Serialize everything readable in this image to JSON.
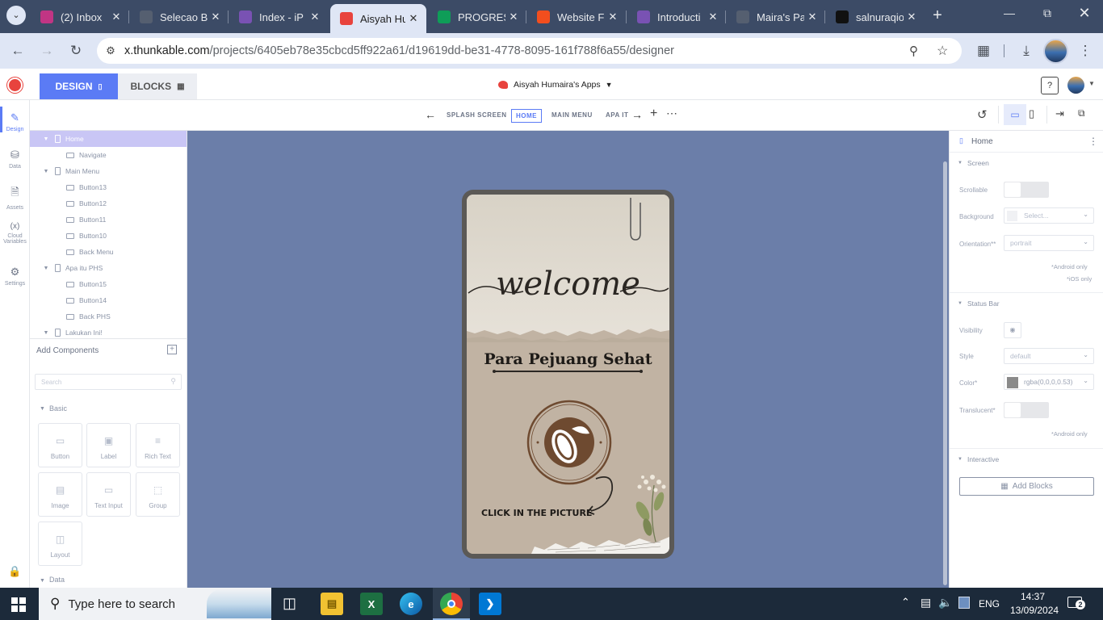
{
  "browser": {
    "tabs": [
      {
        "title": "(2) Inbox",
        "icon": "instagram-icon",
        "color": "#c13584"
      },
      {
        "title": "Selecao B",
        "icon": "github-icon",
        "color": "#555f70"
      },
      {
        "title": "Index - iP",
        "icon": "bootstrap-icon",
        "color": "#7952b3"
      },
      {
        "title": "Aisyah Hu",
        "icon": "thunkable-icon",
        "color": "#e8433d"
      },
      {
        "title": "PROGRES",
        "icon": "sheets-icon",
        "color": "#0f9d58"
      },
      {
        "title": "Website F",
        "icon": "figma-icon",
        "color": "#f24e1e"
      },
      {
        "title": "Introducti",
        "icon": "bootstrap-icon",
        "color": "#7952b3"
      },
      {
        "title": "Maira's Pa",
        "icon": "github-icon",
        "color": "#555f70"
      },
      {
        "title": "salnuraqio",
        "icon": "site-icon",
        "color": "#111111"
      }
    ],
    "url_domain": "x.thunkable.com",
    "url_path": "/projects/6405eb78e35cbcd5ff922a61/d19619dd-be31-4778-8095-161f788f6a55/designer"
  },
  "app": {
    "design_tab": "DESIGN",
    "blocks_tab": "BLOCKS",
    "project_name": "Aisyah Humaira's Apps",
    "accent": "#5b7bf5"
  },
  "screen_nav": {
    "prev": "SPLASH SCREEN",
    "current": "HOME",
    "next": "MAIN MENU",
    "next2": "APA IT"
  },
  "rail": [
    {
      "label": "Design",
      "icon": "brush-icon"
    },
    {
      "label": "Data",
      "icon": "database-icon"
    },
    {
      "label": "Assets",
      "icon": "file-icon"
    },
    {
      "label": "Cloud Variables",
      "glyph": "(x)",
      "icon": "variable-icon"
    },
    {
      "label": "Settings",
      "icon": "gear-icon"
    }
  ],
  "tree": [
    {
      "label": "Home",
      "type": "screen",
      "depth": 0,
      "selected": true
    },
    {
      "label": "Navigate",
      "type": "comp",
      "depth": 1
    },
    {
      "label": "Main Menu",
      "type": "screen",
      "depth": 0
    },
    {
      "label": "Button13",
      "type": "comp",
      "depth": 1
    },
    {
      "label": "Button12",
      "type": "comp",
      "depth": 1
    },
    {
      "label": "Button11",
      "type": "comp",
      "depth": 1
    },
    {
      "label": "Button10",
      "type": "comp",
      "depth": 1
    },
    {
      "label": "Back Menu",
      "type": "comp",
      "depth": 1
    },
    {
      "label": "Apa itu PHS",
      "type": "screen",
      "depth": 0
    },
    {
      "label": "Button15",
      "type": "comp",
      "depth": 1
    },
    {
      "label": "Button14",
      "type": "comp",
      "depth": 1
    },
    {
      "label": "Back PHS",
      "type": "comp",
      "depth": 1
    },
    {
      "label": "Lakukan Ini!",
      "type": "screen",
      "depth": 0
    }
  ],
  "components": {
    "title": "Add Components",
    "search_placeholder": "Search",
    "basic": "Basic",
    "items": [
      "Button",
      "Label",
      "Rich Text",
      "Image",
      "Text Input",
      "Group",
      "Layout"
    ],
    "data": "Data"
  },
  "props": {
    "screen_name": "Home",
    "screen_section": "Screen",
    "scrollable": "Scrollable",
    "background": "Background",
    "background_value": "Select...",
    "orientation": "Orientation**",
    "orientation_value": "portrait",
    "android_only": "*Android only",
    "ios_only": "*iOS only",
    "status_bar": "Status Bar",
    "visibility": "Visibility",
    "style": "Style",
    "style_value": "default",
    "color": "Color*",
    "color_value": "rgba(0,0,0,0.53)",
    "translucent": "Translucent*",
    "android_only2": "*Android only",
    "interactive": "Interactive",
    "add_blocks": "Add Blocks"
  },
  "phone": {
    "welcome": "welcome",
    "subtitle": "Para Pejuang Sehat",
    "cta": "CLICK IN THE PICTURE"
  },
  "taskbar": {
    "search": "Type here to search",
    "lang": "ENG",
    "time": "14:37",
    "date": "13/09/2024",
    "notif": "2"
  }
}
